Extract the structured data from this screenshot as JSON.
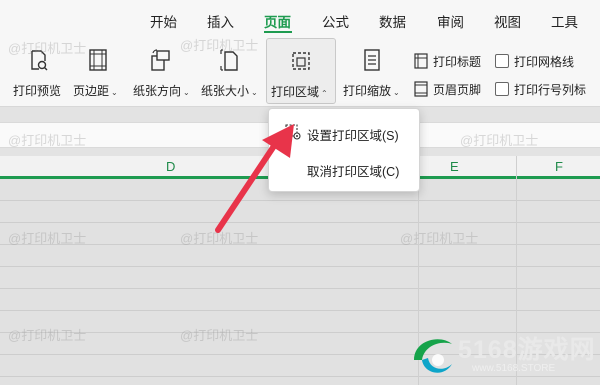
{
  "tabs": [
    {
      "label": "开始"
    },
    {
      "label": "插入"
    },
    {
      "label": "页面"
    },
    {
      "label": "公式"
    },
    {
      "label": "数据"
    },
    {
      "label": "审阅"
    },
    {
      "label": "视图"
    },
    {
      "label": "工具"
    }
  ],
  "active_tab": "页面",
  "ribbon": {
    "print_preview": "打印预览",
    "margins": "页边距",
    "orientation": "纸张方向",
    "paper_size": "纸张大小",
    "print_area": "打印区域",
    "print_scale": "打印缩放",
    "print_titles": "打印标题",
    "header_footer": "页眉页脚",
    "print_gridlines": "打印网格线",
    "print_row_col_headers": "打印行号列标"
  },
  "columns": [
    "D",
    "E",
    "F"
  ],
  "menu": {
    "set_print_area": "设置打印区域(S)",
    "cancel_print_area": "取消打印区域(C)"
  },
  "watermark": "@打印机卫士",
  "logo": {
    "main": "5168游戏网",
    "sub": "www.5168.STORE"
  },
  "colors": {
    "accent": "#1e9b50",
    "arrow": "#e8344a"
  }
}
